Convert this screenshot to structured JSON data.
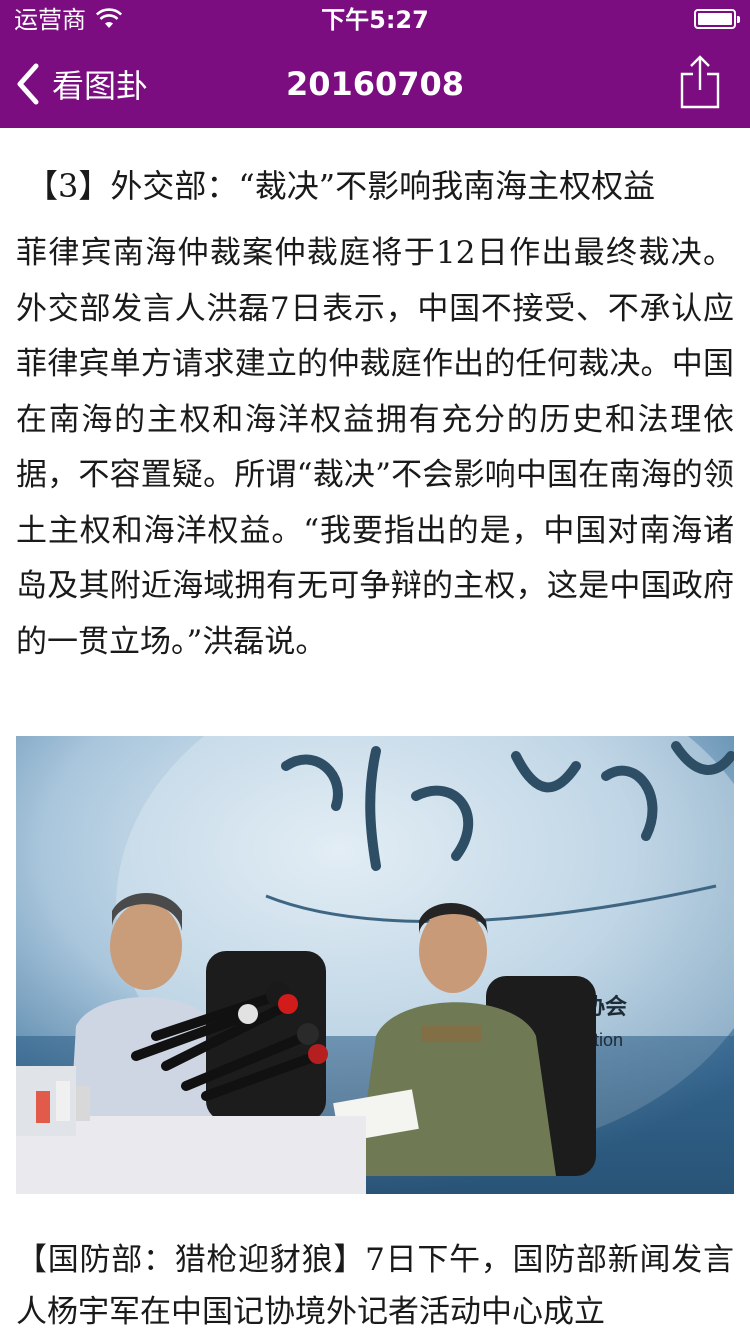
{
  "status_bar": {
    "carrier": "运营商",
    "time": "下午5:27"
  },
  "nav": {
    "back_label": "看图卦",
    "title": "20160708"
  },
  "article": {
    "headline": "【3】外交部：“裁决”不影响我南海主权权益",
    "paragraph1": "菲律宾南海仲裁案仲裁庭将于12日作出最终裁决。外交部发言人洪磊7日表示，中国不接受、不承认应菲律宾单方请求建立的仲裁庭作出的任何裁决。中国在南海的主权和海洋权益拥有充分的历史和法理依据，不容置疑。所谓“裁决”不会影响中国在南海的领土主权和海洋权益。“我要指出的是，中国对南海诸岛及其附近海域拥有无可争辩的主权，这是中国政府的一贯立场。”洪磊说。",
    "paragraph2": "【国防部：猎枪迎豺狼】7日下午，国防部新闻发言人杨宇军在中国记协境外记者活动中心成立"
  },
  "colors": {
    "nav_background": "#7b0d80",
    "text": "#1a1a1a"
  },
  "icons": {
    "back": "chevron-left-icon",
    "share": "share-icon",
    "wifi": "wifi-icon",
    "battery": "battery-icon"
  }
}
